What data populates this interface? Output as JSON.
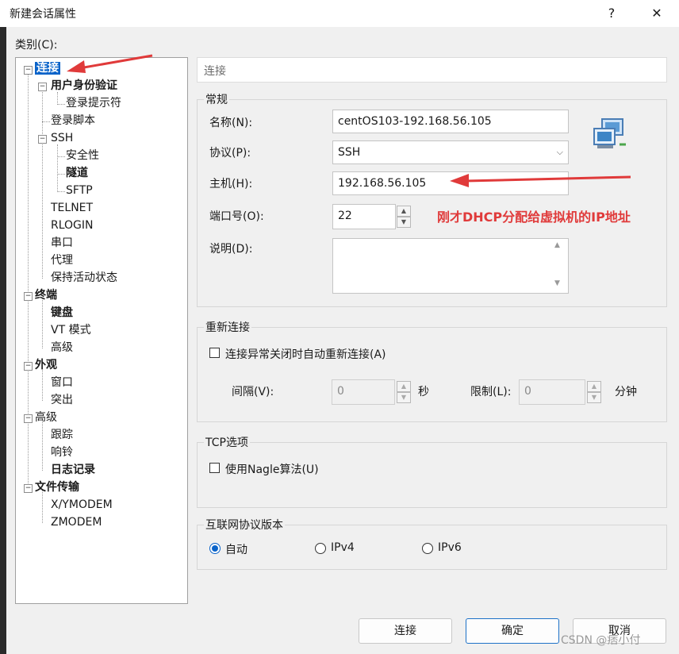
{
  "window": {
    "title": "新建会话属性",
    "help_label": "?",
    "close_label": "✕"
  },
  "category_label": "类别(C):",
  "tree": {
    "connection": "连接",
    "user_auth": "用户身份验证",
    "login_prompt": "登录提示符",
    "login_script": "登录脚本",
    "ssh": "SSH",
    "security": "安全性",
    "tunnel": "隧道",
    "sftp": "SFTP",
    "telnet": "TELNET",
    "rlogin": "RLOGIN",
    "serial": "串口",
    "proxy": "代理",
    "keepalive": "保持活动状态",
    "terminal": "终端",
    "keyboard": "键盘",
    "vt_mode": "VT 模式",
    "advanced_term": "高级",
    "appearance": "外观",
    "window": "窗口",
    "highlight": "突出",
    "advanced": "高级",
    "trace": "跟踪",
    "bell": "响铃",
    "logging": "日志记录",
    "file_transfer": "文件传输",
    "xymodem": "X/YMODEM",
    "zmodem": "ZMODEM"
  },
  "section_title": "连接",
  "general": {
    "title": "常规",
    "name_label": "名称(N):",
    "name_value": "centOS103-192.168.56.105",
    "protocol_label": "协议(P):",
    "protocol_value": "SSH",
    "host_label": "主机(H):",
    "host_value": "192.168.56.105",
    "port_label": "端口号(O):",
    "port_value": "22",
    "desc_label": "说明(D):",
    "desc_value": ""
  },
  "annotation": "刚才DHCP分配给虚拟机的IP地址",
  "reconnect": {
    "title": "重新连接",
    "auto_label": "连接异常关闭时自动重新连接(A)",
    "interval_label": "间隔(V):",
    "interval_value": "0",
    "interval_unit": "秒",
    "limit_label": "限制(L):",
    "limit_value": "0",
    "limit_unit": "分钟"
  },
  "tcp": {
    "title": "TCP选项",
    "nagle_label": "使用Nagle算法(U)"
  },
  "ip_version": {
    "title": "互联网协议版本",
    "auto": "自动",
    "ipv4": "IPv4",
    "ipv6": "IPv6"
  },
  "buttons": {
    "connect": "连接",
    "ok": "确定",
    "cancel": "取消"
  },
  "watermark": "CSDN @痞小付",
  "colors": {
    "selection": "#0a63c9",
    "annotation": "#e03a3a"
  }
}
